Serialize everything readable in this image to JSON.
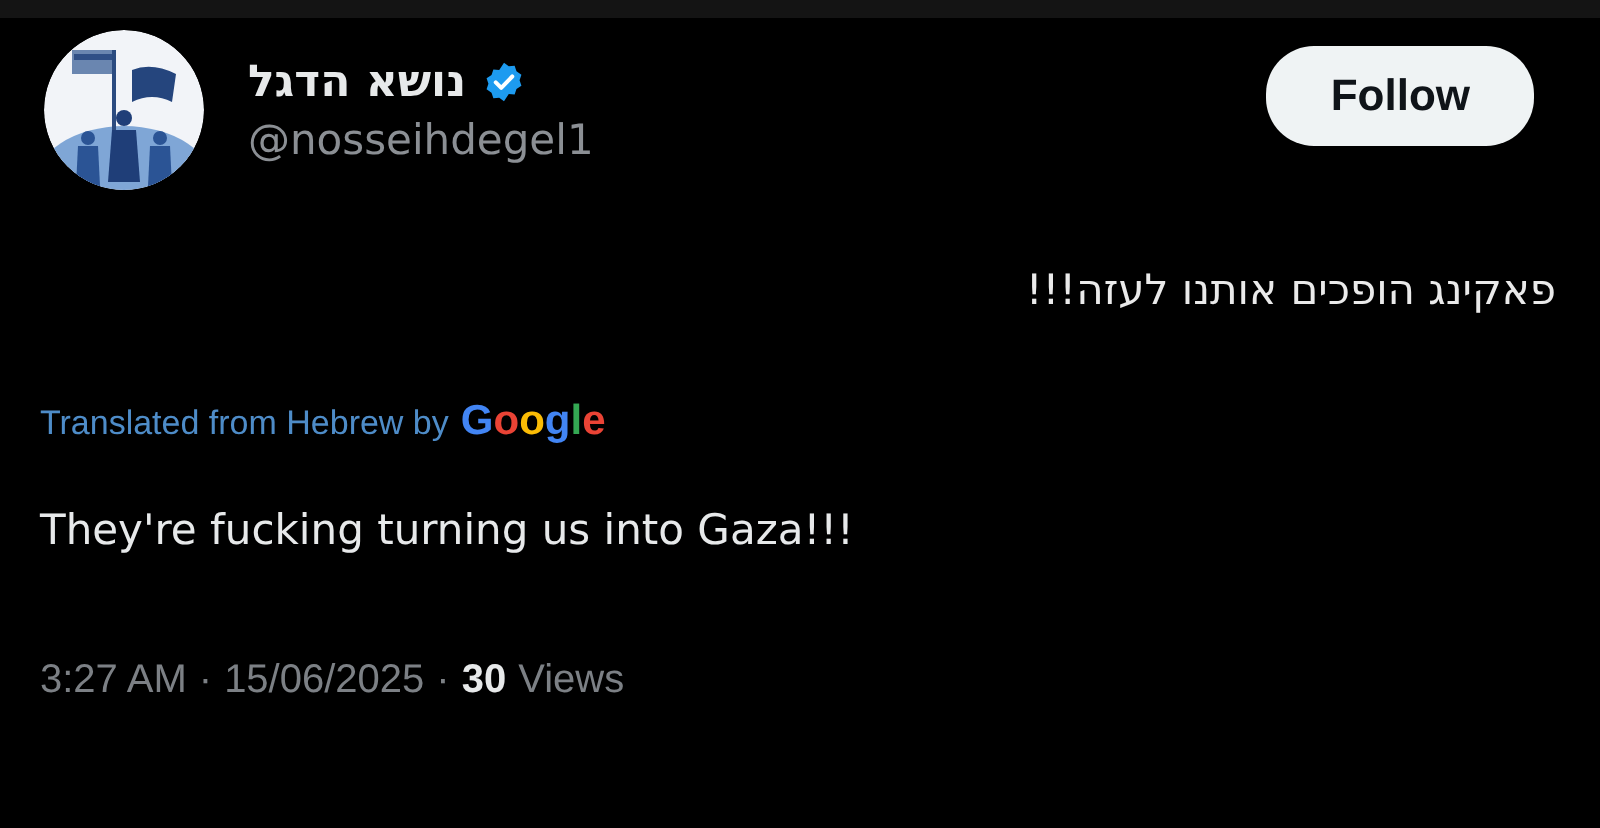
{
  "author": {
    "name": "נושא הדגל",
    "verified": true,
    "handle": "@nosseihdegel1"
  },
  "follow_button": {
    "label": "Follow"
  },
  "tweet_text": "פאקינג הופכים אותנו לעזה!!!",
  "translation": {
    "label": "Translated from Hebrew by",
    "provider": "Google"
  },
  "translated_text": "They're fucking turning us into Gaza!!!",
  "meta": {
    "separator": "·",
    "time": "3:27 AM",
    "date": "15/06/2025",
    "views_count": "30",
    "views_label": "Views"
  }
}
